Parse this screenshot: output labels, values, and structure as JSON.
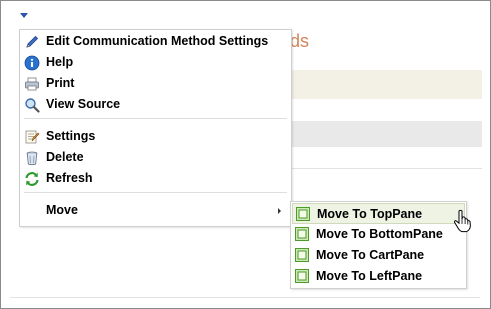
{
  "background": {
    "title_fragment": "ds"
  },
  "menu": {
    "items": [
      {
        "label": "Edit Communication Method Settings",
        "icon": "pencil-icon"
      },
      {
        "label": "Help",
        "icon": "help-icon"
      },
      {
        "label": "Print",
        "icon": "print-icon"
      },
      {
        "label": "View Source",
        "icon": "magnifier-icon"
      },
      {
        "label": "Settings",
        "icon": "settings-icon"
      },
      {
        "label": "Delete",
        "icon": "trash-icon"
      },
      {
        "label": "Refresh",
        "icon": "refresh-icon"
      },
      {
        "label": "Move",
        "icon": "submenu-arrow-icon"
      }
    ]
  },
  "submenu": {
    "items": [
      {
        "label": "Move To TopPane",
        "icon": "pane-icon",
        "state": "hover"
      },
      {
        "label": "Move To BottomPane",
        "icon": "pane-icon"
      },
      {
        "label": "Move To CartPane",
        "icon": "pane-icon"
      },
      {
        "label": "Move To LeftPane",
        "icon": "pane-icon"
      }
    ]
  },
  "colors": {
    "accent_title": "#d2855a",
    "trigger": "#2a55a8",
    "hover_bg": "#eef3e4",
    "pane_icon_green": "#4c9a2a"
  }
}
